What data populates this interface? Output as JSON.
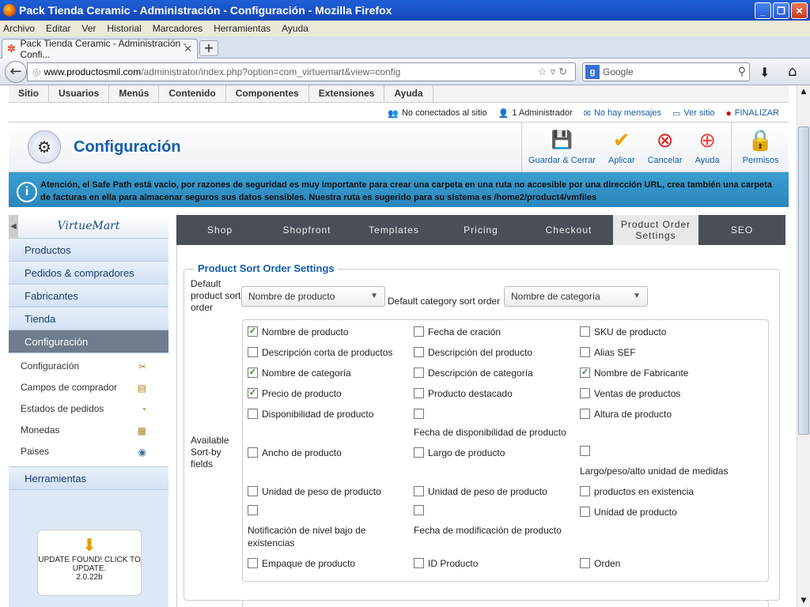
{
  "window": {
    "title": "Pack Tienda Ceramic - Administración - Configuración - Mozilla Firefox",
    "menu": [
      "Archivo",
      "Editar",
      "Ver",
      "Historial",
      "Marcadores",
      "Herramientas",
      "Ayuda"
    ],
    "tab_title": "Pack Tienda Ceramic - Administración - Confi...",
    "url_host": "www.productosmil.com",
    "url_path": "/administrator/index.php?option=com_virtuemart&view=config",
    "search_placeholder": "Google"
  },
  "admin": {
    "menu": [
      "Sitio",
      "Usuarios",
      "Menús",
      "Contenido",
      "Componentes",
      "Extensiones",
      "Ayuda"
    ],
    "status": {
      "visitors": "No conectados al sitio",
      "admins": "1 Administrador",
      "messages": "No hay mensajes",
      "view_site": "Ver sitio",
      "logout": "FINALIZAR"
    },
    "page_title": "Configuración",
    "toolbar": {
      "save_close": "Guardar & Cerrar",
      "apply": "Aplicar",
      "cancel": "Cancelar",
      "help": "Ayuda",
      "permissions": "Permisos"
    },
    "notice": "Atención, el Safe Path está vacio, por razones de seguridad es muy importante para crear una carpeta en una ruta no accesible por una dirección URL, crea también una carpeta de facturas en ella para almacenar seguros sus datos sensibles. Nuestra ruta es sugerido para su sistema es /home2/product4/vmfiles"
  },
  "sidebar": {
    "logo": "VirtueMart",
    "items": [
      "Productos",
      "Pedidos & compradores",
      "Fabricantes",
      "Tienda",
      "Configuración"
    ],
    "sub_items": [
      "Configuración",
      "Campos de comprador",
      "Estados de pedidos",
      "Monedas",
      "Paises"
    ],
    "tools": "Herramientas",
    "update_text": "UPDATE FOUND! CLICK TO UPDATE.",
    "update_version": "2.0.22b"
  },
  "tabs": [
    {
      "label": "Shop",
      "active": false
    },
    {
      "label": "Shopfront",
      "active": false
    },
    {
      "label": "Templates",
      "active": false
    },
    {
      "label": "Pricing",
      "active": false
    },
    {
      "label": "Checkout",
      "active": false
    },
    {
      "label": "Product Order Settings",
      "active": true
    },
    {
      "label": "SEO",
      "active": false
    }
  ],
  "form": {
    "legend": "Product Sort Order Settings",
    "default_sort_label": "Default product sort order",
    "default_sort_value": "Nombre de producto",
    "default_cat_label": "Default category sort order",
    "default_cat_value": "Nombre de categoría",
    "available_label": "Available Sort-by fields",
    "checkboxes": [
      {
        "label": "Nombre de producto",
        "checked": true
      },
      {
        "label": "Fecha de cración",
        "checked": false
      },
      {
        "label": "SKU de producto",
        "checked": false
      },
      {
        "label": "Descripción corta de productos",
        "checked": false
      },
      {
        "label": "Descripción del producto",
        "checked": false
      },
      {
        "label": "Alias SEF",
        "checked": false
      },
      {
        "label": "Nombre de categoría",
        "checked": true
      },
      {
        "label": "Descripción de categoría",
        "checked": false
      },
      {
        "label": "Nombre de Fabricante",
        "checked": true
      },
      {
        "label": "Precio de producto",
        "checked": true
      },
      {
        "label": "Producto destacado",
        "checked": false
      },
      {
        "label": "Ventas de productos",
        "checked": false
      },
      {
        "label": "Disponibilidad de producto",
        "checked": false
      },
      {
        "label": "Fecha de disponibilidad de producto",
        "checked": false
      },
      {
        "label": "Altura de producto",
        "checked": false
      },
      {
        "label": "Ancho de producto",
        "checked": false
      },
      {
        "label": "Largo de producto",
        "checked": false
      },
      {
        "label": "Largo/peso/alto unidad de medidas",
        "checked": false
      },
      {
        "label": "Unidad de peso de producto",
        "checked": false
      },
      {
        "label": "Unidad de peso de producto",
        "checked": false
      },
      {
        "label": "productos en existencia",
        "checked": false
      },
      {
        "label": "Notificación de nivel bajo de existencias",
        "checked": false
      },
      {
        "label": "Fecha de modificación de producto",
        "checked": false
      },
      {
        "label": "Unidad de producto",
        "checked": false
      },
      {
        "label": "Empaque de producto",
        "checked": false
      },
      {
        "label": "ID Producto",
        "checked": false
      },
      {
        "label": "Orden",
        "checked": false
      }
    ]
  }
}
